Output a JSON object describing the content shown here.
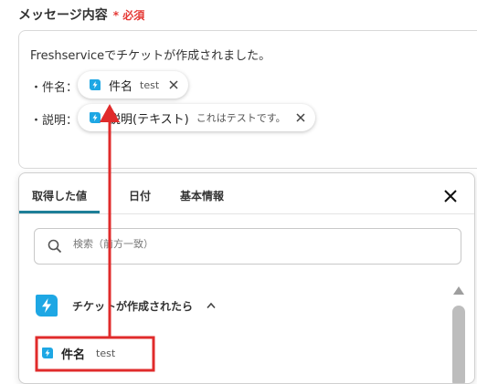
{
  "field": {
    "label": "メッセージ内容",
    "required_mark": "*",
    "required_text": "必須"
  },
  "message": {
    "line1": "Freshserviceでチケットが作成されました。",
    "name_label": "・件名：",
    "desc_label": "・説明："
  },
  "chips": [
    {
      "name": "件名",
      "value": "test"
    },
    {
      "name": "説明(テキスト)",
      "value": "これはテストです。"
    }
  ],
  "panel": {
    "tabs": [
      "取得した値",
      "日付",
      "基本情報"
    ],
    "search_placeholder": "検索（前方一致）",
    "section_title": "チケットが作成されたら",
    "item": {
      "name": "件名",
      "value": "test"
    }
  },
  "colors": {
    "app_icon": "#1ea7e4",
    "annotation": "#e02b2b",
    "tab_underline": "#1e7f98",
    "required": "#e53935"
  }
}
